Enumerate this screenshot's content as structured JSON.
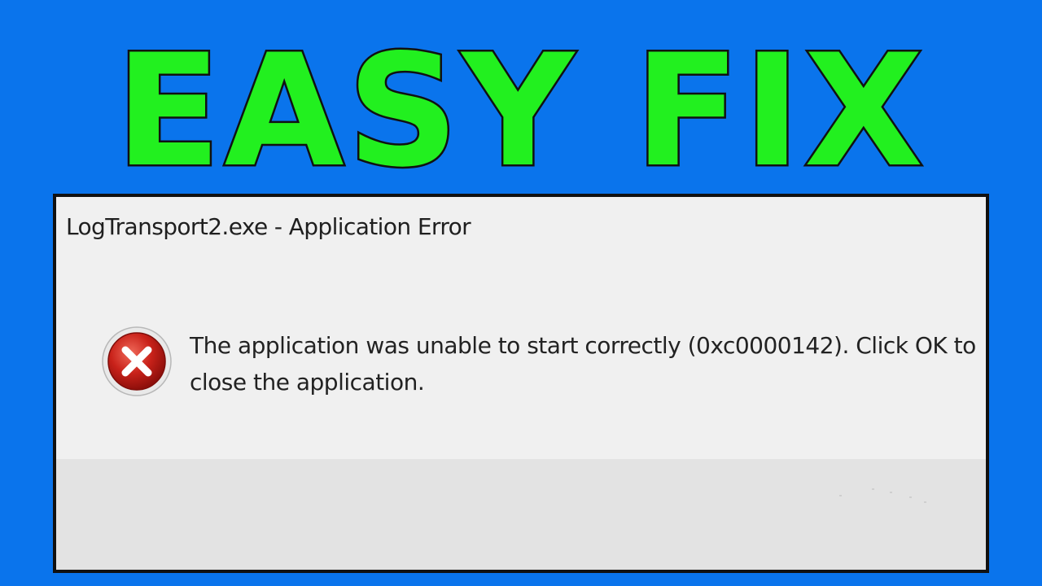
{
  "banner": {
    "headline": "EASY FIX",
    "fill_color": "#22f01f",
    "outline_color": "#111111"
  },
  "background_color": "#0a74ec",
  "dialog": {
    "title": "LogTransport2.exe - Application Error",
    "icon": "error-x-icon",
    "message": "The application was unable to start correctly (0xc0000142). Click OK to close the application.",
    "background_color": "#f0f0f0",
    "footer_color": "#e3e3e3"
  }
}
